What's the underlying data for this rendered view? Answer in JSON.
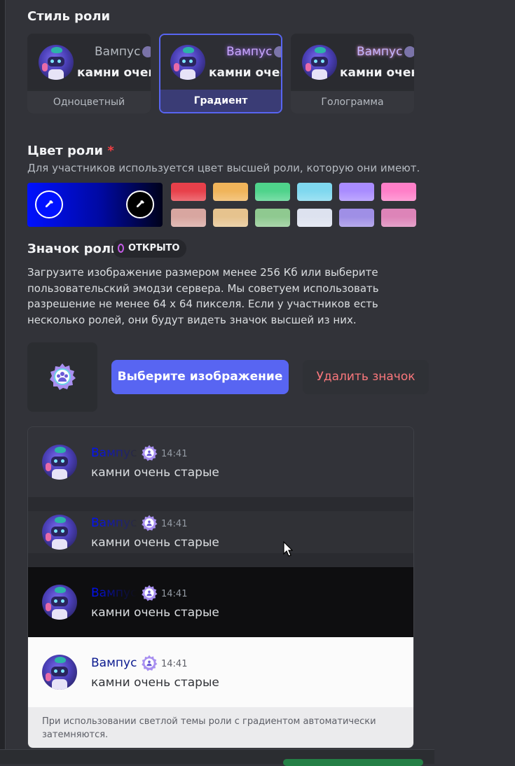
{
  "role_style": {
    "heading": "Стиль роли",
    "cards": [
      {
        "label": "Одноцветный",
        "name": "Вампус",
        "message": "камни очень",
        "selected": false
      },
      {
        "label": "Градиент",
        "name": "Вампус",
        "message": "камни очень",
        "selected": true
      },
      {
        "label": "Голограмма",
        "name": "Вампус",
        "message": "камни очень",
        "selected": false
      }
    ]
  },
  "role_color": {
    "heading": "Цвет роли",
    "required_mark": "*",
    "description": "Для участников используется цвет высшей роли, которую они имеют.",
    "gradient_start": "#0011ff",
    "gradient_end": "#00021a",
    "swatches_row1": [
      "#e8404a",
      "#f0b45a",
      "#4fd38b",
      "#7fd8ef",
      "#a98cff",
      "#ff7fc8"
    ],
    "swatches_row2": [
      "#d8a6a0",
      "#e6c38e",
      "#8fc990",
      "#dde2ef",
      "#9f8fe6",
      "#dd84b8"
    ]
  },
  "role_icon": {
    "heading": "Значок роли",
    "badge": "ОТКРЫТО",
    "description": "Загрузите изображение размером менее 256 Кб или выберите пользовательский эмодзи сервера. Мы советуем использовать разрешение не менее 64 x 64 пикселя. Если у участников есть несколько ролей, они будут видеть значок высшей из них.",
    "choose_button": "Выберите изображение",
    "remove_button": "Удалить значок"
  },
  "previews": {
    "rows": [
      {
        "name": "Вампус",
        "time": "14:41",
        "text": "камни очень старые",
        "theme": "dark"
      },
      {
        "name": "Вампус",
        "time": "14:41",
        "text": "камни очень старые",
        "theme": "darker"
      },
      {
        "name": "Вампус",
        "time": "14:41",
        "text": "камни очень старые",
        "theme": "black"
      },
      {
        "name": "Вампус",
        "time": "14:41",
        "text": "камни очень старые",
        "theme": "light"
      }
    ],
    "footer": "При использовании светлой темы роли с градиентом автоматически затемняются."
  }
}
